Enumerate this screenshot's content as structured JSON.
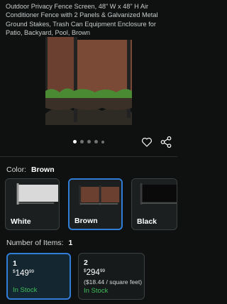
{
  "product": {
    "title": "Outdoor Privacy Fence Screen, 48\" W x 48\" H Air Conditioner Fence with 2 Panels & Galvanized Metal Ground Stakes, Trash Can Equipment Enclosure for Patio, Backyard, Pool, Brown"
  },
  "carousel": {
    "count": 5,
    "active_index": 0
  },
  "actions": {
    "favorite_icon": "heart-icon",
    "share_icon": "share-icon"
  },
  "color": {
    "label": "Color:",
    "selected": "Brown",
    "options": [
      {
        "name": "White",
        "swatch": "#d4d4d4"
      },
      {
        "name": "Brown",
        "swatch": "#6b4030"
      },
      {
        "name": "Black",
        "swatch": "#1e1e1e"
      }
    ]
  },
  "quantity": {
    "label": "Number of Items:",
    "selected": "1",
    "options": [
      {
        "count": "1",
        "price_symbol": "$",
        "price_whole": "149",
        "price_fraction": "99",
        "unit_price": "",
        "stock": "In Stock"
      },
      {
        "count": "2",
        "price_symbol": "$",
        "price_whole": "294",
        "price_fraction": "99",
        "unit_price": "($18.44 / square feet)",
        "stock": "In Stock"
      }
    ]
  },
  "colors": {
    "accent": "#2f7dd6",
    "stock": "#3fbf5c",
    "background": "#0f1111"
  }
}
